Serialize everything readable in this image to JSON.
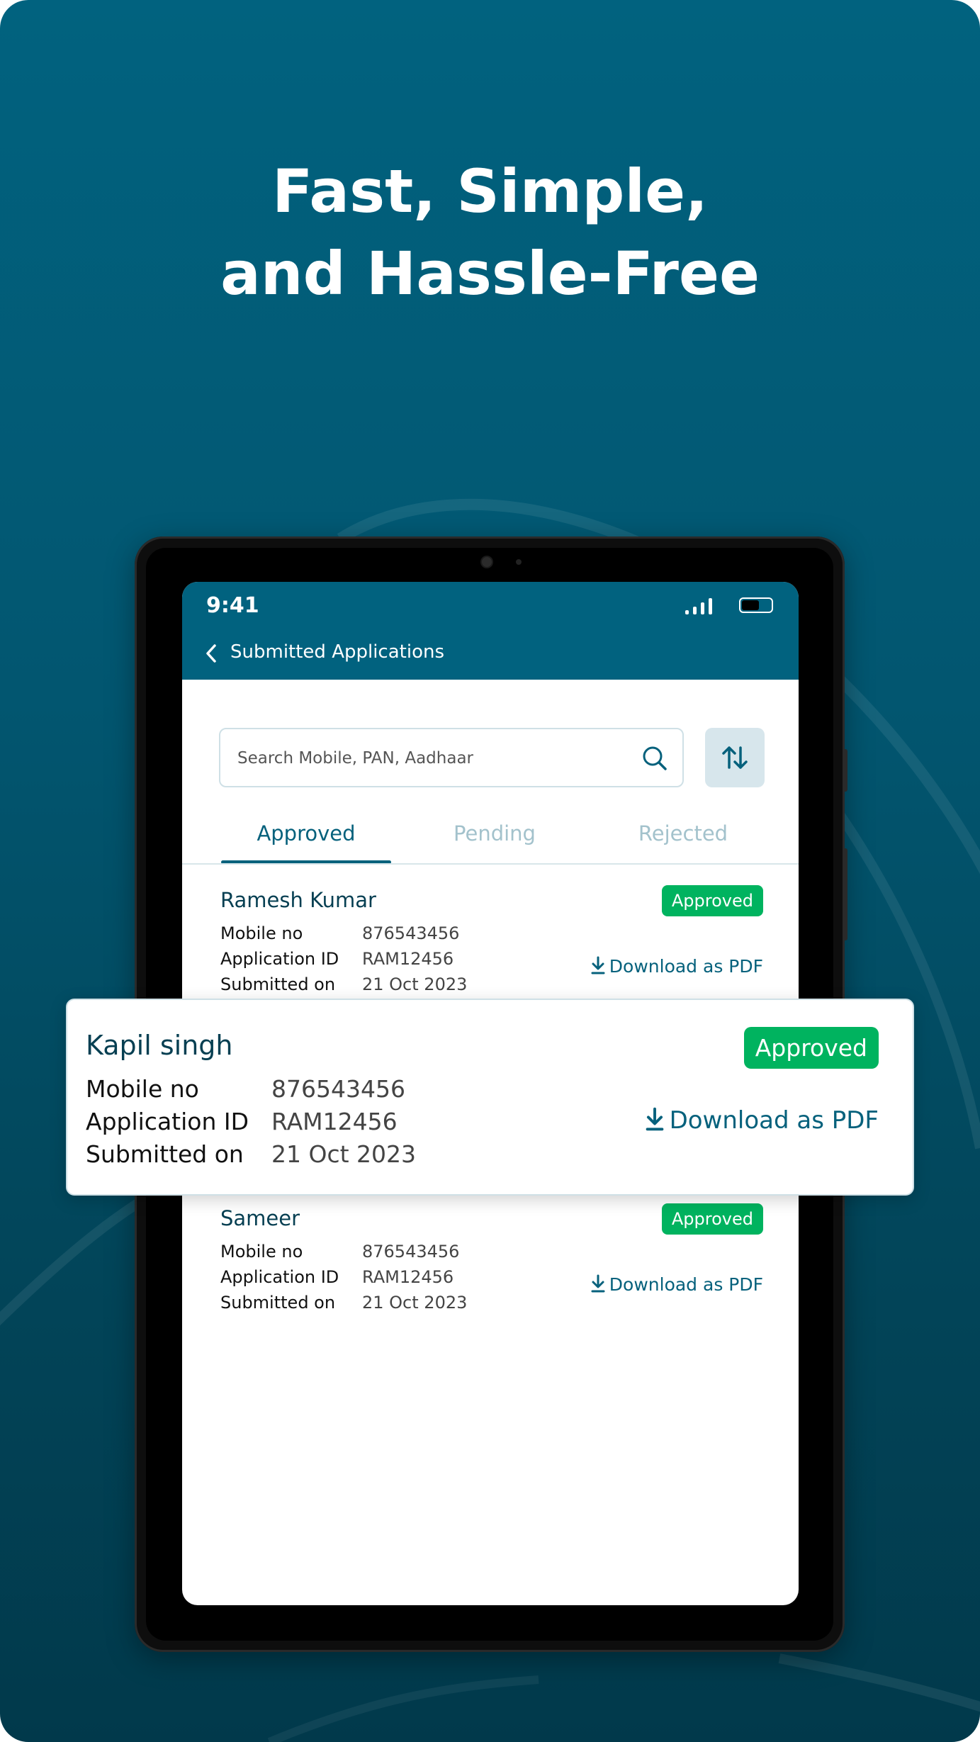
{
  "headline": {
    "line1": "Fast, Simple,",
    "line2": "and Hassle-Free"
  },
  "status_bar": {
    "time": "9:41"
  },
  "header": {
    "title": "Submitted Applications"
  },
  "search": {
    "placeholder": "Search Mobile, PAN, Aadhaar"
  },
  "tabs": [
    {
      "label": "Approved",
      "active": true
    },
    {
      "label": "Pending",
      "active": false
    },
    {
      "label": "Rejected",
      "active": false
    }
  ],
  "field_labels": {
    "mobile": "Mobile no",
    "app_id": "Application ID",
    "submitted": "Submitted on"
  },
  "download_label": "Download as PDF",
  "applications": [
    {
      "name": "Ramesh Kumar",
      "status": "Approved",
      "mobile": "876543456",
      "app_id": "RAM12456",
      "submitted": "21 Oct 2023"
    },
    {
      "name": "Kapil singh",
      "status": "Approved",
      "mobile": "876543456",
      "app_id": "RAM12456",
      "submitted": "21 Oct 2023"
    },
    {
      "name": "Sameer",
      "status": "Approved",
      "mobile": "876543456",
      "app_id": "RAM12456",
      "submitted": "21 Oct 2023"
    }
  ],
  "colors": {
    "primary": "#01627f",
    "approved_badge": "#00b35f",
    "tab_active": "#06617c",
    "tab_inactive": "#a3c2cc"
  }
}
